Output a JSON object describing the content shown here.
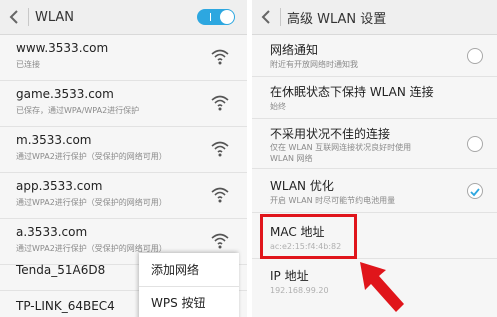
{
  "left": {
    "title": "WLAN",
    "networks": [
      {
        "name": "www.3533.com",
        "status": "已连接"
      },
      {
        "name": "game.3533.com",
        "status": "已保存，通过WPA/WPA2进行保护"
      },
      {
        "name": "m.3533.com",
        "status": "通过WPA2进行保护（受保护的网络可用）"
      },
      {
        "name": "app.3533.com",
        "status": "通过WPA2进行保护（受保护的网络可用）"
      },
      {
        "name": "a.3533.com",
        "status": "通过WPA2进行保护（受保护的网络可用）"
      },
      {
        "name": "Tenda_51A6D8",
        "status": ""
      },
      {
        "name": "TP-LINK_64BEC4",
        "status": ""
      }
    ],
    "menu": {
      "add_network": "添加网络",
      "wps_button": "WPS 按钮"
    }
  },
  "right": {
    "title": "高级 WLAN 设置",
    "settings": [
      {
        "title": "网络通知",
        "subtitle": "附近有开放网络时通知我",
        "checked": false
      },
      {
        "title": "在休眠状态下保持 WLAN 连接",
        "subtitle": "始终"
      },
      {
        "title": "不采用状况不佳的连接",
        "subtitle_line1": "仅在 WLAN 互联网连接状况良好时使用",
        "subtitle_line2": "WLAN 网络",
        "checked": false
      },
      {
        "title": "WLAN 优化",
        "subtitle": "开启 WLAN 时尽可能节约电池用量",
        "checked": true
      },
      {
        "title": "MAC 地址",
        "subtitle": "ac:e2:15:f4:4b:82"
      },
      {
        "title": "IP 地址",
        "subtitle": "192.168.99.20"
      }
    ]
  },
  "colors": {
    "accent": "#2da7e0",
    "highlight": "#e0151b"
  }
}
